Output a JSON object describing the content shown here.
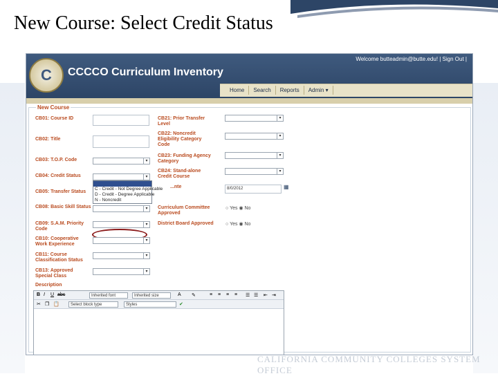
{
  "slide": {
    "title": "New Course: Select Credit Status",
    "footer": "CALIFORNIA COMMUNITY COLLEGES SYSTEM OFFICE"
  },
  "app": {
    "title": "CCCCO Curriculum Inventory",
    "welcome": "Welcome butteadmin@butte.edu! | Sign Out |"
  },
  "nav": [
    "Home",
    "Search",
    "Reports",
    "Admin"
  ],
  "form": {
    "legend": "New Course",
    "left_labels": [
      "CB01: Course ID",
      "CB02: Title",
      "CB03: T.O.P. Code",
      "CB04: Credit Status",
      "CB05: Transfer Status",
      "CB08: Basic Skill Status",
      "CB09: S.A.M. Priority Code",
      "CB10: Cooperative Work Experience",
      "CB11: Course Classification Status",
      "CB13: Approved Special Class"
    ],
    "right_labels": [
      "CB21: Prior Transfer Level",
      "CB22: Noncredit Eligibility Category Code",
      "CB23: Funding Agency Category",
      "CB24: Stand-alone Credit Course",
      "...nte",
      "Curriculum Committee Approved",
      "District Board Approved"
    ],
    "date_value": "8/0/2012",
    "radio_yes": "Yes",
    "radio_no": "No",
    "description_label": "Description",
    "credit_dropdown_options": [
      "C - Credit - Not Degree Applicable",
      "D - Credit - Degree Applicable",
      "N - Noncredit"
    ]
  },
  "editor": {
    "font_select": "Inherited font",
    "size_select": "Inherited size",
    "para_select": "Select block type",
    "style_select": "Styles"
  }
}
